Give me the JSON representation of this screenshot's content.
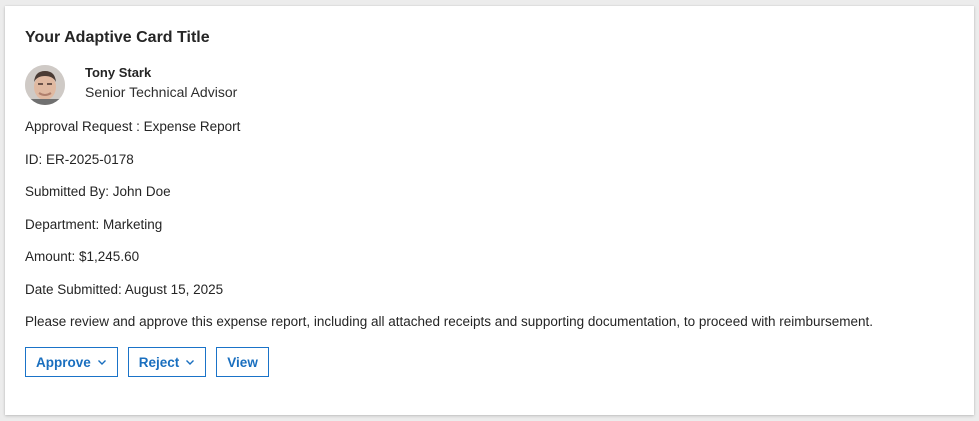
{
  "card": {
    "title": "Your Adaptive Card Title",
    "person": {
      "name": "Tony Stark",
      "role": "Senior Technical Advisor"
    },
    "facts": [
      "Approval Request : Expense Report",
      "ID: ER-2025-0178",
      "Submitted By: John Doe",
      "Department: Marketing",
      "Amount: $1,245.60",
      "Date Submitted: August 15, 2025",
      "Please review and approve this expense report, including all attached receipts and supporting documentation, to proceed with reimbursement."
    ],
    "actions": {
      "approve": "Approve",
      "reject": "Reject",
      "view": "View"
    }
  },
  "colors": {
    "accent": "#1a6fbf",
    "text": "#252525",
    "background": "#ffffff"
  },
  "icons": {
    "dropdown": "chevron-down-icon",
    "avatar": "avatar-photo"
  }
}
